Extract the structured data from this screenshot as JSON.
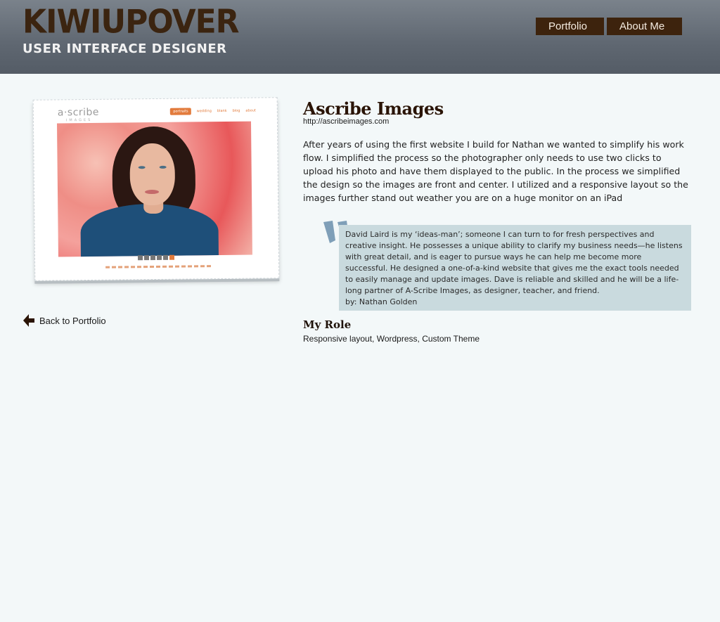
{
  "header": {
    "brand": "KIWIUPOVER",
    "tagline": "USER INTERFACE DESIGNER",
    "nav": [
      {
        "label": "Portfolio"
      },
      {
        "label": "About Me"
      }
    ],
    "colors": {
      "bar": "#5f6771",
      "brand": "#3b2410",
      "nav_button": "#3d230d"
    }
  },
  "preview": {
    "logo": "a·scribe",
    "logo_sub": "IMAGES",
    "nav_items": [
      "portraits",
      "wedding",
      "blank",
      "blog",
      "about"
    ],
    "thumbnail_count": 6,
    "footer_text": "© 2013 A-Scribe Images. All rights reserved."
  },
  "back_link": {
    "label": "Back to Portfolio",
    "icon": "arrow-left-icon"
  },
  "project": {
    "title": "Ascribe Images",
    "url": "http://ascribeimages.com",
    "description": "After years of using the first website I build for Nathan we wanted to simplify his work flow. I simplified the process so the photographer only needs to use two clicks to upload his photo and have them displayed to the public. In the process we simplified the design so the images are front and center. I utilized and a responsive layout so the images further stand out weather you are on a huge monitor on an iPad",
    "testimonial": {
      "text": "David Laird is my ‘ideas-man’; someone I can turn to for fresh perspectives and creative insight. He possesses a unique ability to clarify my business needs—he listens with great detail, and is eager to pursue ways he can help me become more successful. He designed a one-of-a-kind website that gives me the exact tools needed to easily manage and update images. Dave is reliable and skilled and he will be a life-long partner of A-Scribe Images, as designer, teacher, and friend.",
      "author": "by: Nathan Golden",
      "quote_color": "#7f9fb8",
      "box_color": "#c9dade"
    },
    "role_title": "My Role",
    "role_text": "Responsive layout, Wordpress, Custom Theme"
  }
}
